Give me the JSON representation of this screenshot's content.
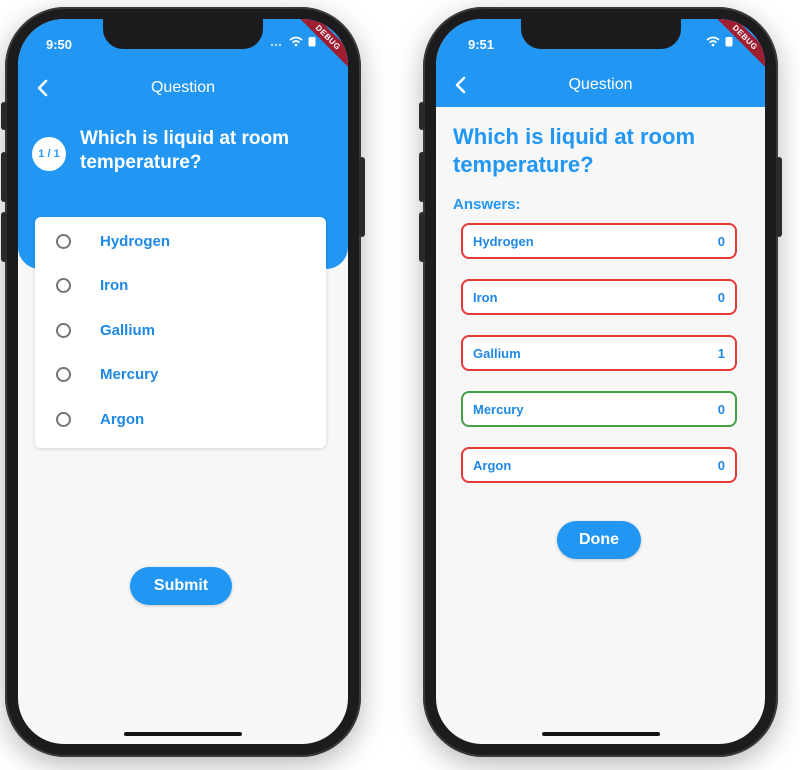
{
  "colors": {
    "primary": "#2196f3",
    "wrong": "#e53935",
    "correct": "#43a047",
    "debug": "#a01e32"
  },
  "icons": [
    "back-arrow-icon",
    "wifi-icon",
    "battery-icon",
    "cellular-signal-icon"
  ],
  "left_screen": {
    "status": {
      "time": "9:50",
      "debug": "DEBUG"
    },
    "appbar": {
      "title": "Question"
    },
    "counter": "1 / 1",
    "question": "Which is liquid at room temperature?",
    "options": [
      {
        "label": "Hydrogen"
      },
      {
        "label": "Iron"
      },
      {
        "label": "Gallium"
      },
      {
        "label": "Mercury"
      },
      {
        "label": "Argon"
      }
    ],
    "submit_label": "Submit"
  },
  "right_screen": {
    "status": {
      "time": "9:51",
      "debug": "DEBUG"
    },
    "appbar": {
      "title": "Question"
    },
    "question": "Which is liquid at room temperature?",
    "answers_label": "Answers:",
    "answers": [
      {
        "name": "Hydrogen",
        "count": "0",
        "status": "wrong"
      },
      {
        "name": "Iron",
        "count": "0",
        "status": "wrong"
      },
      {
        "name": "Gallium",
        "count": "1",
        "status": "wrong"
      },
      {
        "name": "Mercury",
        "count": "0",
        "status": "correct"
      },
      {
        "name": "Argon",
        "count": "0",
        "status": "wrong"
      }
    ],
    "done_label": "Done"
  }
}
